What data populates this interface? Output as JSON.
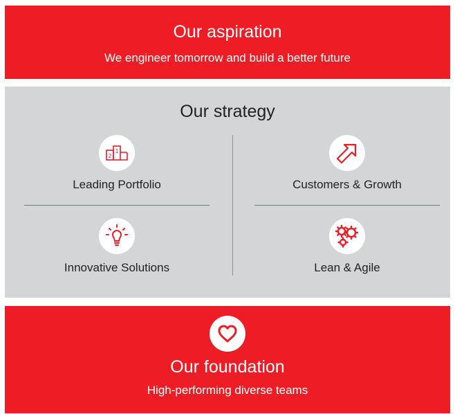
{
  "aspiration": {
    "title": "Our aspiration",
    "subtitle": "We engineer tomorrow and build a better future"
  },
  "strategy": {
    "title": "Our strategy",
    "items": [
      {
        "label": "Leading Portfolio",
        "icon": "podium-icon"
      },
      {
        "label": "Customers & Growth",
        "icon": "arrow-up-right-icon"
      },
      {
        "label": "Innovative Solutions",
        "icon": "lightbulb-icon"
      },
      {
        "label": "Lean & Agile",
        "icon": "gears-icon"
      }
    ]
  },
  "foundation": {
    "title": "Our foundation",
    "subtitle": "High-performing diverse teams",
    "icon": "heart-icon"
  },
  "colors": {
    "red": "#ee1c25",
    "grey": "#d4d5d7",
    "divider": "#6e7d78",
    "white": "#ffffff"
  }
}
